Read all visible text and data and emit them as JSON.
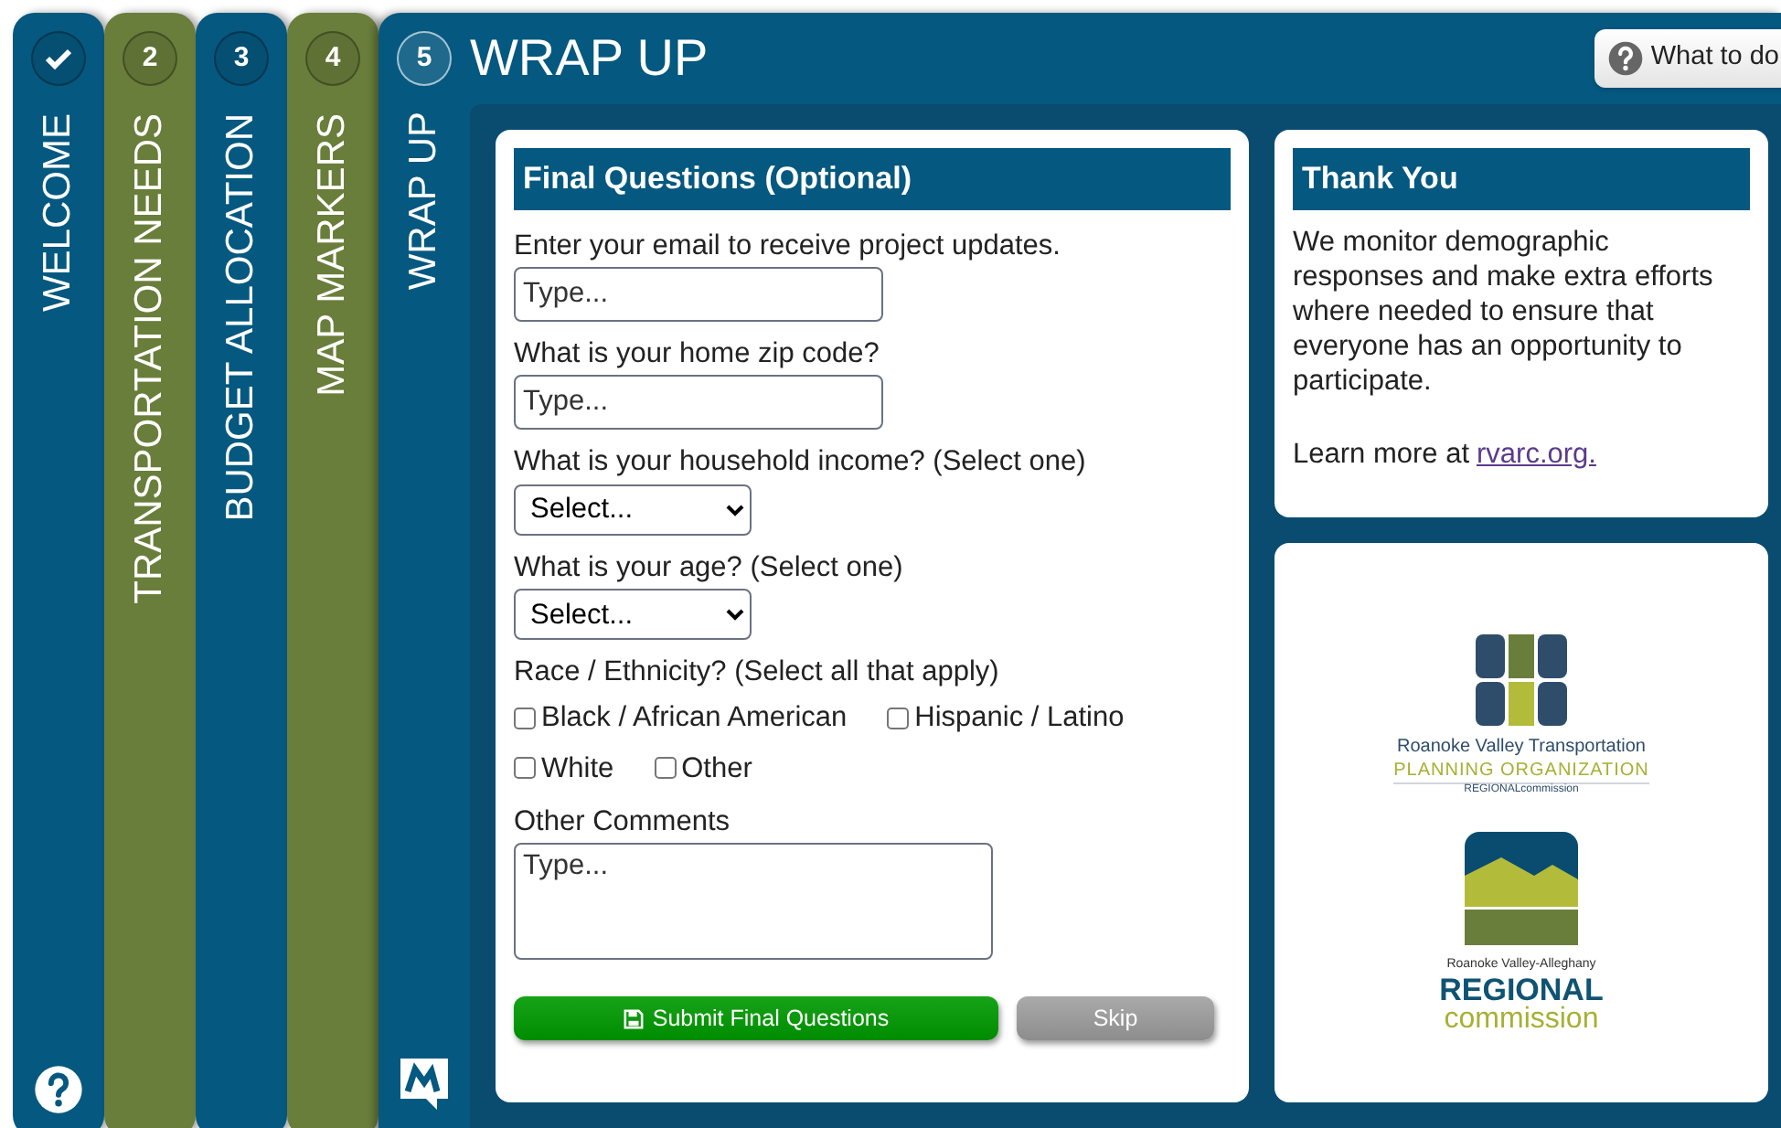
{
  "tabs": [
    {
      "kind": "done",
      "label": "WELCOME",
      "color": "#05587f",
      "selected": false
    },
    {
      "kind": "step",
      "number": "2",
      "label": "TRANSPORTATION NEEDS",
      "color": "#6a7e3b",
      "selected": false
    },
    {
      "kind": "step",
      "number": "3",
      "label": "BUDGET ALLOCATION",
      "color": "#05587f",
      "selected": false
    },
    {
      "kind": "step",
      "number": "4",
      "label": "MAP MARKERS",
      "color": "#6a7e3b",
      "selected": false
    },
    {
      "kind": "step",
      "number": "5",
      "label": "WRAP UP",
      "color": "#05587f",
      "selected": true
    }
  ],
  "page_title": "WRAP UP",
  "help_button": "What to do",
  "form": {
    "title": "Final Questions (Optional)",
    "questions": [
      {
        "kind": "text",
        "label": "Enter your email to receive project updates.",
        "placeholder": "Type..."
      },
      {
        "kind": "text",
        "label": "What is your home zip code?",
        "placeholder": "Type..."
      },
      {
        "kind": "select",
        "label": "What is your household income? (Select one)",
        "value": "Select..."
      },
      {
        "kind": "select",
        "label": "What is your age? (Select one)",
        "value": "Select..."
      },
      {
        "kind": "checkboxes",
        "label": "Race / Ethnicity? (Select all that apply)",
        "options": [
          {
            "label": "Black / African American",
            "checked": false
          },
          {
            "label": "Hispanic / Latino",
            "checked": false
          },
          {
            "label": "White",
            "checked": false
          },
          {
            "label": "Other",
            "checked": false
          }
        ]
      },
      {
        "kind": "textarea",
        "label": "Other Comments",
        "placeholder": "Type..."
      }
    ],
    "submit": "Submit Final Questions",
    "skip": "Skip"
  },
  "thank_you": {
    "title": "Thank You",
    "body": "We monitor demographic responses and make extra efforts where needed to ensure that everyone has an opportunity to participate.",
    "learn_more": "Learn more at",
    "link": "rvarc.org."
  },
  "logos": {
    "tpo": [
      "Roanoke Valley Transportation",
      "PLANNING ORGANIZATION",
      "REGIONALcommission"
    ],
    "rc": [
      "Roanoke Valley-Alleghany",
      "REGIONAL",
      "commission"
    ]
  }
}
